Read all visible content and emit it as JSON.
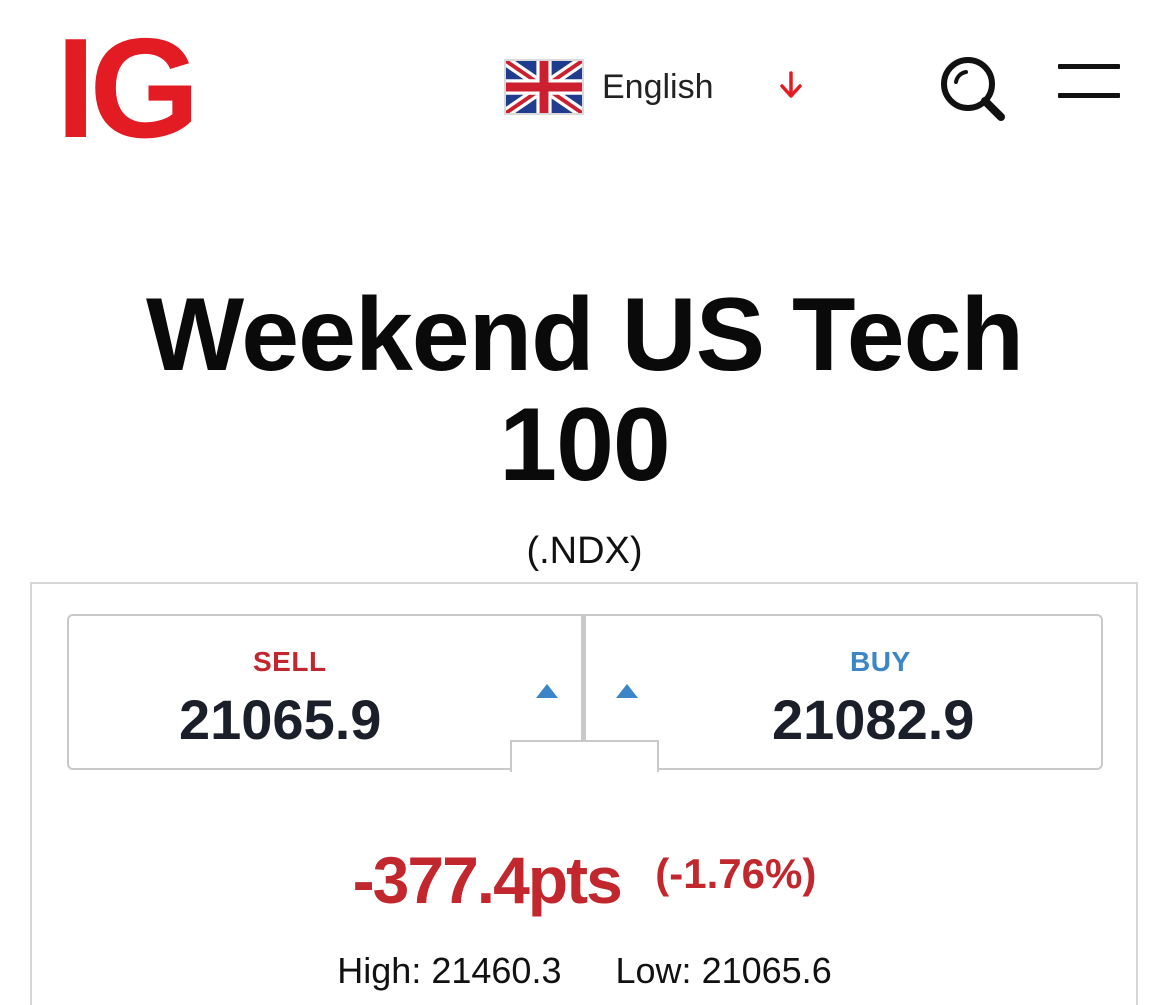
{
  "header": {
    "logo_text": "IG",
    "language": {
      "label": "English",
      "flag_icon": "uk-flag-icon",
      "dropdown_icon": "arrow-down-icon"
    },
    "search_icon": "search-icon",
    "menu_icon": "hamburger-menu-icon"
  },
  "instrument": {
    "title_line1": "Weekend US Tech",
    "title_line2": "100",
    "ticker": "(.NDX)"
  },
  "pricing": {
    "sell_label": "SELL",
    "sell_price": "21065.9",
    "buy_label": "BUY",
    "buy_price": "21082.9",
    "change_points": "-377.4pts",
    "change_percent": "(-1.76%)",
    "high_label": "High:",
    "high_value": "21460.3",
    "low_label": "Low:",
    "low_value": "21065.6"
  },
  "colors": {
    "brand_red": "#e31b23",
    "sell_red": "#c1272d",
    "buy_blue": "#3a86c8",
    "price_text": "#1b1f2a"
  }
}
